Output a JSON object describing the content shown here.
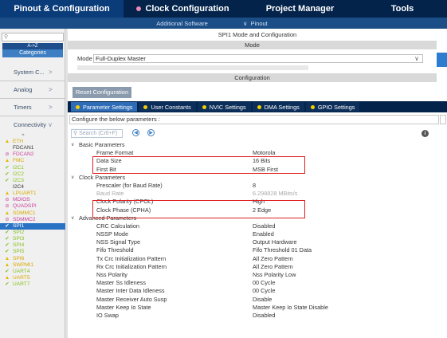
{
  "top_tabs": [
    {
      "label": "Pinout & Configuration",
      "active": true
    },
    {
      "label": "Clock Configuration",
      "active": false
    },
    {
      "label": "Project Manager",
      "active": false
    },
    {
      "label": "Tools",
      "active": false
    }
  ],
  "sub_bar": {
    "additional_software": "Additional Software",
    "pinout": "Pinout"
  },
  "left": {
    "search_placeholder": "",
    "sort_label": "A->Z",
    "categories_label": "Categories",
    "categories": [
      {
        "label": "System C...",
        "caret": ">"
      },
      {
        "label": "Analog",
        "caret": ">"
      },
      {
        "label": "Timers",
        "caret": ">"
      },
      {
        "label": "Connectivity",
        "caret": "v"
      }
    ],
    "up_caret": "^",
    "peripherals": [
      {
        "label": "ETH",
        "status": "warn"
      },
      {
        "label": "FDCAN1",
        "status": "none"
      },
      {
        "label": "FDCAN2",
        "status": "no"
      },
      {
        "label": "FMC",
        "status": "warn"
      },
      {
        "label": "I2C1",
        "status": "ok"
      },
      {
        "label": "I2C2",
        "status": "ok"
      },
      {
        "label": "I2C3",
        "status": "ok"
      },
      {
        "label": "I2C4",
        "status": "none"
      },
      {
        "label": "LPUART1",
        "status": "warn"
      },
      {
        "label": "MDIOS",
        "status": "no"
      },
      {
        "label": "QUADSPI",
        "status": "no"
      },
      {
        "label": "SDMMC1",
        "status": "warn"
      },
      {
        "label": "SDMMC2",
        "status": "no"
      },
      {
        "label": "SPI1",
        "status": "ok",
        "selected": true
      },
      {
        "label": "SPI2",
        "status": "ok"
      },
      {
        "label": "SPI3",
        "status": "ok"
      },
      {
        "label": "SPI4",
        "status": "ok"
      },
      {
        "label": "SPI5",
        "status": "ok"
      },
      {
        "label": "SPI6",
        "status": "warn"
      },
      {
        "label": "SWPMI1",
        "status": "warn"
      },
      {
        "label": "UART4",
        "status": "ok"
      },
      {
        "label": "UART5",
        "status": "warn"
      },
      {
        "label": "UART7",
        "status": "ok"
      }
    ]
  },
  "main": {
    "title": "SPI1 Mode and Configuration",
    "mode_header": "Mode",
    "mode_label": "Mode",
    "mode_value": "Full-Duplex Master",
    "config_header": "Configuration",
    "reset_button": "Reset Configuration",
    "config_tabs": [
      "Parameter Settings",
      "User Constants",
      "NVIC Settings",
      "DMA Settings",
      "GPIO Settings"
    ],
    "description": "Configure the below parameters :",
    "search_placeholder": "Search (Crtl+F)"
  },
  "parameters": [
    {
      "group": "Basic Parameters"
    },
    {
      "name": "Frame Format",
      "value": "Motorola"
    },
    {
      "name": "Data Size",
      "value": "16 Bits"
    },
    {
      "name": "First Bit",
      "value": "MSB First"
    },
    {
      "group": "Clock Parameters"
    },
    {
      "name": "Prescaler (for Baud Rate)",
      "value": "8"
    },
    {
      "name": "Baud Rate",
      "value": "6.298828 MBits/s",
      "disabled": true
    },
    {
      "name": "Clock Polarity (CPOL)",
      "value": "High"
    },
    {
      "name": "Clock Phase (CPHA)",
      "value": "2 Edge"
    },
    {
      "group": "Advanced Parameters"
    },
    {
      "name": "CRC Calculation",
      "value": "Disabled"
    },
    {
      "name": "NSSP Mode",
      "value": "Enabled"
    },
    {
      "name": "NSS Signal Type",
      "value": "Output Hardware"
    },
    {
      "name": "Fifo Threshold",
      "value": "Fifo Threshold 01 Data"
    },
    {
      "name": "Tx Crc Initialization Pattern",
      "value": "All Zero Pattern"
    },
    {
      "name": "Rx Crc Initialization Pattern",
      "value": "All Zero Pattern"
    },
    {
      "name": "Nss Polarity",
      "value": "Nss Polarity Low"
    },
    {
      "name": "Master Ss Idleness",
      "value": "00 Cycle"
    },
    {
      "name": "Master Inter Data Idleness",
      "value": "00 Cycle"
    },
    {
      "name": "Master Receiver Auto Susp",
      "value": "Disable"
    },
    {
      "name": "Master Keep Io State",
      "value": "Master Keep Io State Disable"
    },
    {
      "name": "IO Swap",
      "value": "Disabled"
    }
  ],
  "colors": {
    "top_bar": "#03234b",
    "active_tab": "#0b3c7a",
    "selected": "#2a72c4",
    "highlight_box": "#e02020"
  }
}
